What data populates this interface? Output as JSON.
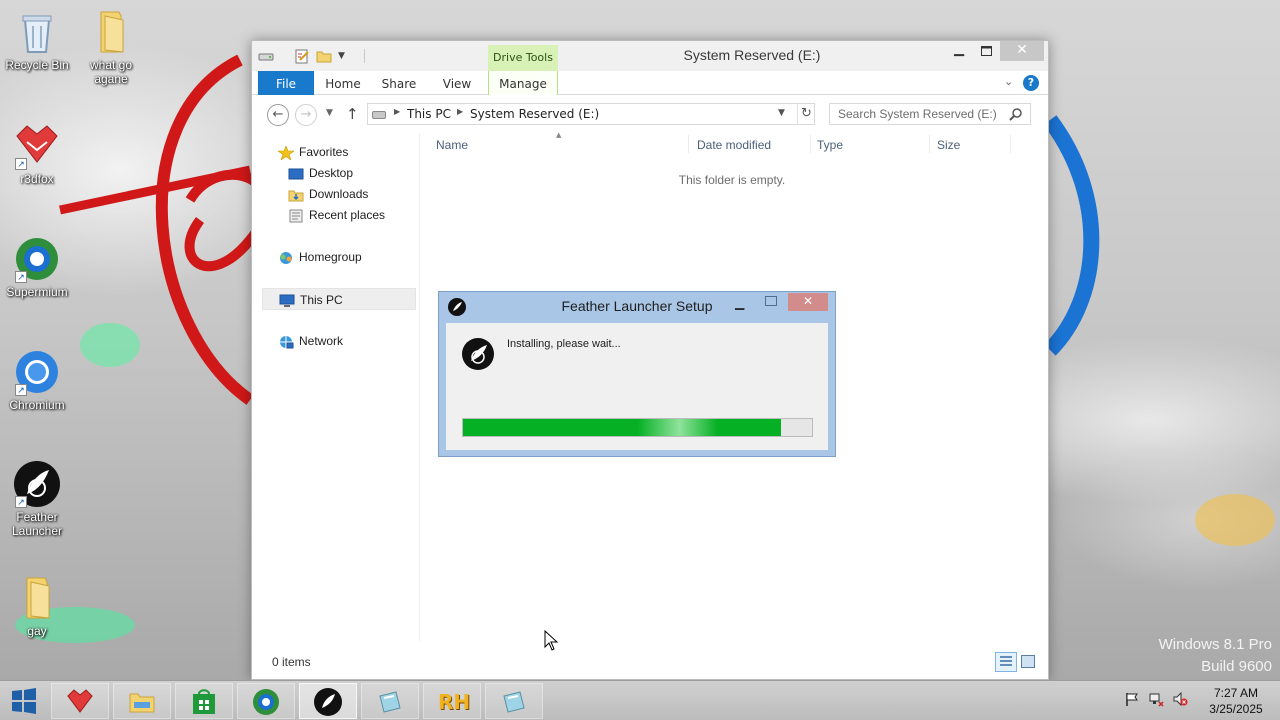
{
  "os": {
    "edition": "Windows 8.1 Pro",
    "build": "Build 9600"
  },
  "desktop": {
    "icons": [
      {
        "label": "Recycle Bin",
        "icon": "recycle-bin-icon"
      },
      {
        "label": "what go agane",
        "icon": "folder-icon"
      },
      {
        "label": "r3dfox",
        "icon": "r3dfox-icon"
      },
      {
        "label": "Supermium",
        "icon": "supermium-icon"
      },
      {
        "label": "Chromium",
        "icon": "chromium-icon"
      },
      {
        "label": "Feather Launcher",
        "icon": "feather-launcher-icon"
      },
      {
        "label": "gay",
        "icon": "folder-icon"
      }
    ]
  },
  "explorer": {
    "title": "System Reserved (E:)",
    "contextual_tab_group": "Drive Tools",
    "ribbon_tabs": [
      "File",
      "Home",
      "Share",
      "View",
      "Manage"
    ],
    "address": {
      "crumbs": [
        "This PC",
        "System Reserved (E:)"
      ]
    },
    "search": {
      "placeholder": "Search System Reserved (E:)"
    },
    "nav_pane": {
      "favorites": "Favorites",
      "favorites_items": [
        "Desktop",
        "Downloads",
        "Recent places"
      ],
      "homegroup": "Homegroup",
      "this_pc": "This PC",
      "network": "Network"
    },
    "columns": [
      "Name",
      "Date modified",
      "Type",
      "Size"
    ],
    "empty_message": "This folder is empty.",
    "status": {
      "item_count": "0 items"
    }
  },
  "setup_dialog": {
    "title": "Feather Launcher Setup",
    "status_text": "Installing, please wait...",
    "progress": 0.91,
    "progress_color": "#06b025"
  },
  "taskbar": {
    "apps": [
      {
        "name": "r3dfox",
        "icon": "r3dfox-icon"
      },
      {
        "name": "File Explorer",
        "icon": "file-explorer-icon"
      },
      {
        "name": "Store",
        "icon": "store-icon"
      },
      {
        "name": "Supermium",
        "icon": "supermium-icon"
      },
      {
        "name": "Feather Launcher",
        "icon": "feather-launcher-icon",
        "active": true
      },
      {
        "name": "Setup",
        "icon": "setup-icon"
      },
      {
        "name": "RH",
        "icon": "rh-icon"
      },
      {
        "name": "Setup",
        "icon": "setup-icon"
      }
    ],
    "clock": {
      "time": "7:27 AM",
      "date": "3/25/2025"
    }
  },
  "colors": {
    "accent": "#1979ca",
    "drive_tools": "#d7f1b6"
  }
}
